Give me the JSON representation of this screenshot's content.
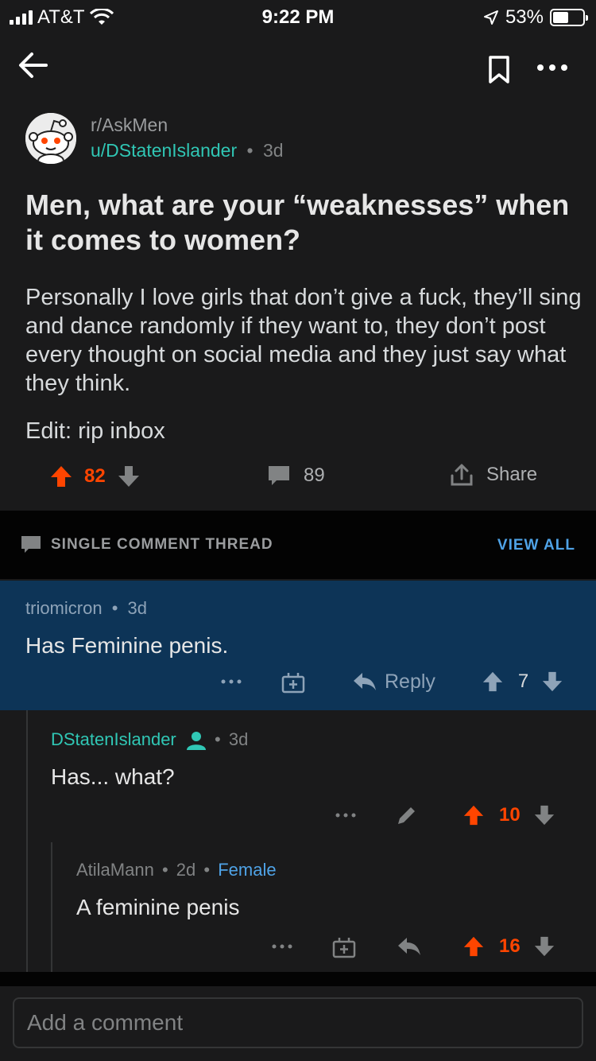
{
  "status_bar": {
    "carrier": "AT&T",
    "time": "9:22 PM",
    "battery": "53%",
    "battery_level": 0.53
  },
  "header": {
    "back_icon": "arrow-left-icon",
    "bookmark_icon": "bookmark-icon",
    "more_icon": "more-horizontal-icon"
  },
  "post": {
    "subreddit": "r/AskMen",
    "author": "u/DStatenIslander",
    "separator": "•",
    "age": "3d",
    "title": "Men, what are your “weaknesses” when it comes to women?",
    "body": "Personally I love girls that don’t give a fuck, they’ll sing and dance randomly if they want to, they don’t post every thought on social media and they just say what they think.",
    "edit": "Edit: rip inbox",
    "score": "82",
    "comments": "89",
    "share_label": "Share"
  },
  "thread_bar": {
    "label": "SINGLE COMMENT THREAD",
    "view_all": "VIEW ALL"
  },
  "comments": [
    {
      "author": "triomicron",
      "separator": "•",
      "age": "3d",
      "body": "Has Feminine penis.",
      "reply_label": "Reply",
      "score": "7"
    },
    {
      "author": "DStatenIslander",
      "separator": "•",
      "age": "3d",
      "body": "Has... what?",
      "score": "10"
    },
    {
      "author": "AtilaMann",
      "separator": "•",
      "age": "2d",
      "separator2": "•",
      "flair": "Female",
      "body": "A feminine penis",
      "score": "16"
    }
  ],
  "composer": {
    "placeholder": "Add a comment"
  },
  "colors": {
    "background": "#1a1a1b",
    "upvote": "#ff4500",
    "highlight": "#0d3457",
    "author_teal": "#30c7b5",
    "link_blue": "#4fa3e7"
  }
}
